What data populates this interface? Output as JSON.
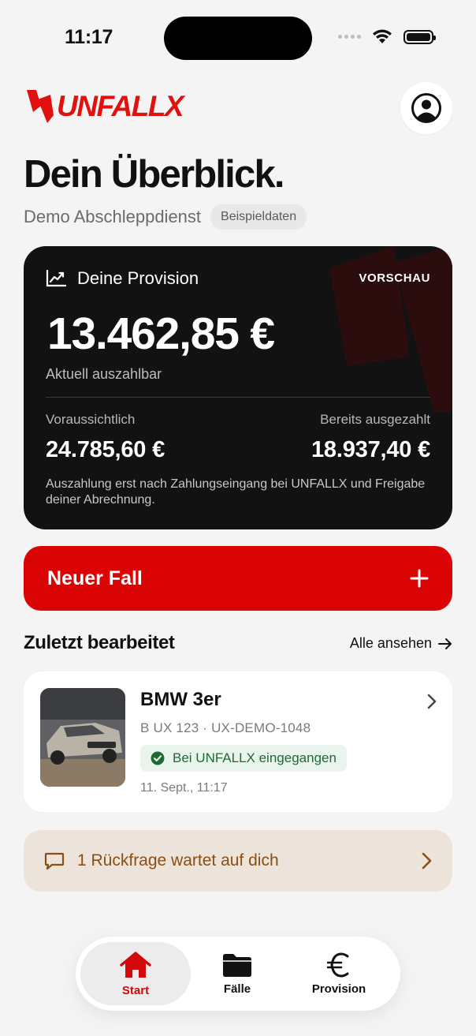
{
  "status_bar": {
    "time": "11:17"
  },
  "brand": {
    "logo_text": "UNFALLX",
    "accent_color": "#da0405"
  },
  "header": {
    "title": "Dein Überblick.",
    "company": "Demo Abschleppdienst",
    "badge": "Beispieldaten",
    "profile_icon": "person-circle-icon"
  },
  "provision_card": {
    "label": "Deine Provision",
    "tag": "VORSCHAU",
    "amount": "13.462,85 €",
    "caption": "Aktuell auszahlbar",
    "expected_label": "Voraussichtlich",
    "expected_value": "24.785,60 €",
    "paid_label": "Bereits ausgezahlt",
    "paid_value": "18.937,40 €",
    "note": "Auszahlung erst nach Zahlungseingang bei UNFALLX und Freigabe deiner Abrechnung."
  },
  "new_case": {
    "label": "Neuer Fall",
    "icon": "plus-icon"
  },
  "recent": {
    "title": "Zuletzt bearbeitet",
    "see_all": "Alle ansehen",
    "case": {
      "title": "BMW 3er",
      "plate": "B UX 123 · UX-DEMO-1048",
      "status": "Bei UNFALLX eingegangen",
      "status_color": "#1f6a34",
      "date": "11. Sept., 11:17"
    }
  },
  "query_banner": {
    "label": "1 Rückfrage wartet auf dich"
  },
  "tab_bar": {
    "tabs": [
      {
        "label": "Start",
        "icon": "home-icon",
        "active": true
      },
      {
        "label": "Fälle",
        "icon": "folder-icon",
        "active": false
      },
      {
        "label": "Provision",
        "icon": "euro-icon",
        "active": false
      }
    ]
  }
}
